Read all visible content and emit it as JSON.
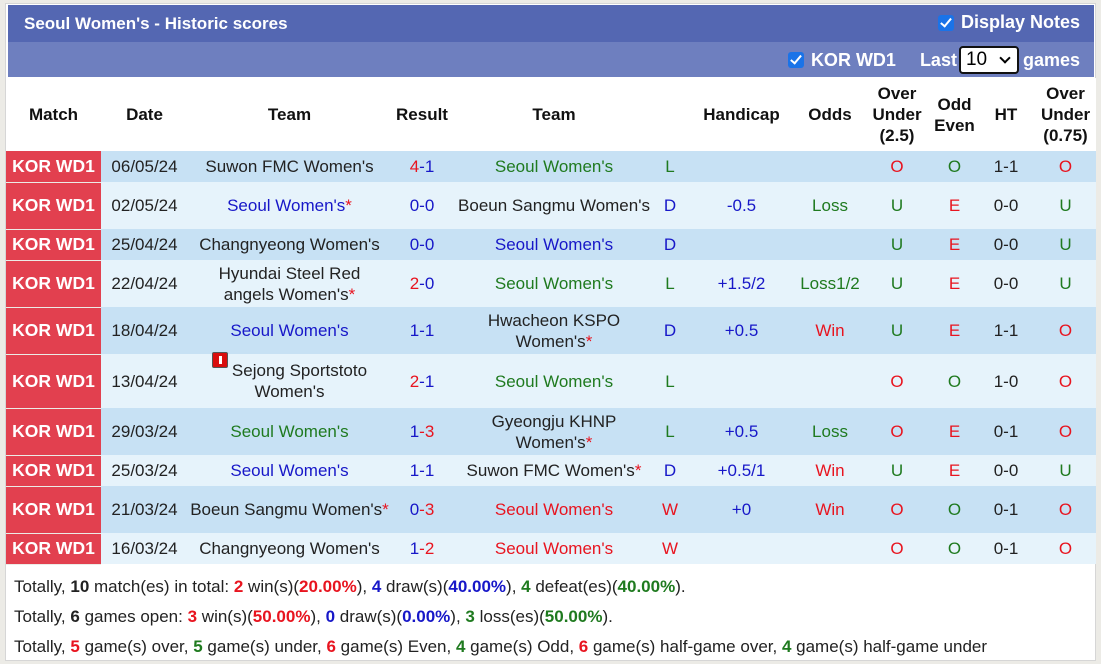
{
  "header": {
    "title": "Seoul Women's - Historic scores",
    "display_notes_label": "Display Notes",
    "display_notes_checked": true
  },
  "filter": {
    "league_label": "KOR WD1",
    "league_checked": true,
    "last_label": "Last",
    "games_count": "10",
    "games_label": "games"
  },
  "columns": [
    "Match",
    "Date",
    "Team",
    "Result",
    "Team",
    "",
    "Handicap",
    "Odds",
    "Over Under (2.5)",
    "Odd Even",
    "HT",
    "Over Under (0.75)"
  ],
  "colors": {
    "league_bg": "#e2404f",
    "header_bg": "#5467b2",
    "filter_bg": "#6e7fbf",
    "win": "#e8141f",
    "draw": "#1717c8",
    "loss": "#1f7a1f"
  },
  "rows": [
    {
      "league": "KOR WD1",
      "date": "06/05/24",
      "home": "Suwon FMC Women's",
      "home_star": false,
      "home_color": "black",
      "home_redcard": false,
      "score_h": "4",
      "score_a": "1",
      "sh_color": "red",
      "sa_color": "blue",
      "away": "Seoul Women's",
      "away_star": false,
      "away_color": "green",
      "wdl": "L",
      "wdl_color": "green",
      "handicap": "",
      "odds": "",
      "odds_color": "",
      "ou": "O",
      "ou_color": "red",
      "oe": "O",
      "oe_color": "green",
      "ht": "1-1",
      "ou2": "O",
      "ou2_color": "red"
    },
    {
      "league": "KOR WD1",
      "date": "02/05/24",
      "home": "Seoul Women's",
      "home_star": true,
      "home_color": "blue",
      "home_redcard": false,
      "score_h": "0",
      "score_a": "0",
      "sh_color": "blue",
      "sa_color": "blue",
      "away": "Boeun Sangmu Women's",
      "away_star": false,
      "away_color": "black",
      "wdl": "D",
      "wdl_color": "blue",
      "handicap": "-0.5",
      "odds": "Loss",
      "odds_color": "green",
      "ou": "U",
      "ou_color": "green",
      "oe": "E",
      "oe_color": "red",
      "ht": "0-0",
      "ou2": "U",
      "ou2_color": "green"
    },
    {
      "league": "KOR WD1",
      "date": "25/04/24",
      "home": "Changnyeong Women's",
      "home_star": false,
      "home_color": "black",
      "home_redcard": false,
      "score_h": "0",
      "score_a": "0",
      "sh_color": "blue",
      "sa_color": "blue",
      "away": "Seoul Women's",
      "away_star": false,
      "away_color": "blue",
      "wdl": "D",
      "wdl_color": "blue",
      "handicap": "",
      "odds": "",
      "odds_color": "",
      "ou": "U",
      "ou_color": "green",
      "oe": "E",
      "oe_color": "red",
      "ht": "0-0",
      "ou2": "U",
      "ou2_color": "green"
    },
    {
      "league": "KOR WD1",
      "date": "22/04/24",
      "home": "Hyundai Steel Red angels Women's",
      "home_star": true,
      "home_color": "black",
      "home_redcard": false,
      "score_h": "2",
      "score_a": "0",
      "sh_color": "red",
      "sa_color": "blue",
      "away": "Seoul Women's",
      "away_star": false,
      "away_color": "green",
      "wdl": "L",
      "wdl_color": "green",
      "handicap": "+1.5/2",
      "odds": "Loss1/2",
      "odds_color": "green",
      "ou": "U",
      "ou_color": "green",
      "oe": "E",
      "oe_color": "red",
      "ht": "0-0",
      "ou2": "U",
      "ou2_color": "green"
    },
    {
      "league": "KOR WD1",
      "date": "18/04/24",
      "home": "Seoul Women's",
      "home_star": false,
      "home_color": "blue",
      "home_redcard": false,
      "score_h": "1",
      "score_a": "1",
      "sh_color": "blue",
      "sa_color": "blue",
      "away": "Hwacheon KSPO Women's",
      "away_star": true,
      "away_color": "black",
      "wdl": "D",
      "wdl_color": "blue",
      "handicap": "+0.5",
      "odds": "Win",
      "odds_color": "red",
      "ou": "U",
      "ou_color": "green",
      "oe": "E",
      "oe_color": "red",
      "ht": "1-1",
      "ou2": "O",
      "ou2_color": "red"
    },
    {
      "league": "KOR WD1",
      "date": "13/04/24",
      "home": "Sejong Sportstoto Women's",
      "home_star": false,
      "home_color": "black",
      "home_redcard": true,
      "score_h": "2",
      "score_a": "1",
      "sh_color": "red",
      "sa_color": "blue",
      "away": "Seoul Women's",
      "away_star": false,
      "away_color": "green",
      "wdl": "L",
      "wdl_color": "green",
      "handicap": "",
      "odds": "",
      "odds_color": "",
      "ou": "O",
      "ou_color": "red",
      "oe": "O",
      "oe_color": "green",
      "ht": "1-0",
      "ou2": "O",
      "ou2_color": "red"
    },
    {
      "league": "KOR WD1",
      "date": "29/03/24",
      "home": "Seoul Women's",
      "home_star": false,
      "home_color": "green",
      "home_redcard": false,
      "score_h": "1",
      "score_a": "3",
      "sh_color": "blue",
      "sa_color": "red",
      "away": "Gyeongju KHNP Women's",
      "away_star": true,
      "away_color": "black",
      "wdl": "L",
      "wdl_color": "green",
      "handicap": "+0.5",
      "odds": "Loss",
      "odds_color": "green",
      "ou": "O",
      "ou_color": "red",
      "oe": "E",
      "oe_color": "red",
      "ht": "0-1",
      "ou2": "O",
      "ou2_color": "red"
    },
    {
      "league": "KOR WD1",
      "date": "25/03/24",
      "home": "Seoul Women's",
      "home_star": false,
      "home_color": "blue",
      "home_redcard": false,
      "score_h": "1",
      "score_a": "1",
      "sh_color": "blue",
      "sa_color": "blue",
      "away": "Suwon FMC Women's",
      "away_star": true,
      "away_color": "black",
      "wdl": "D",
      "wdl_color": "blue",
      "handicap": "+0.5/1",
      "odds": "Win",
      "odds_color": "red",
      "ou": "U",
      "ou_color": "green",
      "oe": "E",
      "oe_color": "red",
      "ht": "0-0",
      "ou2": "U",
      "ou2_color": "green"
    },
    {
      "league": "KOR WD1",
      "date": "21/03/24",
      "home": "Boeun Sangmu Women's",
      "home_star": true,
      "home_color": "black",
      "home_redcard": false,
      "score_h": "0",
      "score_a": "3",
      "sh_color": "blue",
      "sa_color": "red",
      "away": "Seoul Women's",
      "away_star": false,
      "away_color": "red",
      "wdl": "W",
      "wdl_color": "red",
      "handicap": "+0",
      "odds": "Win",
      "odds_color": "red",
      "ou": "O",
      "ou_color": "red",
      "oe": "O",
      "oe_color": "green",
      "ht": "0-1",
      "ou2": "O",
      "ou2_color": "red"
    },
    {
      "league": "KOR WD1",
      "date": "16/03/24",
      "home": "Changnyeong Women's",
      "home_star": false,
      "home_color": "black",
      "home_redcard": false,
      "score_h": "1",
      "score_a": "2",
      "sh_color": "blue",
      "sa_color": "red",
      "away": "Seoul Women's",
      "away_star": false,
      "away_color": "red",
      "wdl": "W",
      "wdl_color": "red",
      "handicap": "",
      "odds": "",
      "odds_color": "",
      "ou": "O",
      "ou_color": "red",
      "oe": "O",
      "oe_color": "green",
      "ht": "0-1",
      "ou2": "O",
      "ou2_color": "red"
    }
  ],
  "summary": [
    [
      {
        "t": "Totally, ",
        "c": ""
      },
      {
        "t": "10",
        "c": "black",
        "b": true
      },
      {
        "t": " match(es) in total: ",
        "c": ""
      },
      {
        "t": "2",
        "c": "red",
        "b": true
      },
      {
        "t": " win(s)(",
        "c": ""
      },
      {
        "t": "20.00%",
        "c": "red",
        "b": true
      },
      {
        "t": "), ",
        "c": ""
      },
      {
        "t": "4",
        "c": "blue",
        "b": true
      },
      {
        "t": " draw(s)(",
        "c": ""
      },
      {
        "t": "40.00%",
        "c": "blue",
        "b": true
      },
      {
        "t": "), ",
        "c": ""
      },
      {
        "t": "4",
        "c": "green",
        "b": true
      },
      {
        "t": " defeat(es)(",
        "c": ""
      },
      {
        "t": "40.00%",
        "c": "green",
        "b": true
      },
      {
        "t": ").",
        "c": ""
      }
    ],
    [
      {
        "t": "Totally, ",
        "c": ""
      },
      {
        "t": "6",
        "c": "black",
        "b": true
      },
      {
        "t": " games open: ",
        "c": ""
      },
      {
        "t": "3",
        "c": "red",
        "b": true
      },
      {
        "t": " win(s)(",
        "c": ""
      },
      {
        "t": "50.00%",
        "c": "red",
        "b": true
      },
      {
        "t": "), ",
        "c": ""
      },
      {
        "t": "0",
        "c": "blue",
        "b": true
      },
      {
        "t": " draw(s)(",
        "c": ""
      },
      {
        "t": "0.00%",
        "c": "blue",
        "b": true
      },
      {
        "t": "), ",
        "c": ""
      },
      {
        "t": "3",
        "c": "green",
        "b": true
      },
      {
        "t": " loss(es)(",
        "c": ""
      },
      {
        "t": "50.00%",
        "c": "green",
        "b": true
      },
      {
        "t": ").",
        "c": ""
      }
    ],
    [
      {
        "t": "Totally, ",
        "c": ""
      },
      {
        "t": "5",
        "c": "red",
        "b": true
      },
      {
        "t": " game(s) over, ",
        "c": ""
      },
      {
        "t": "5",
        "c": "green",
        "b": true
      },
      {
        "t": " game(s) under, ",
        "c": ""
      },
      {
        "t": "6",
        "c": "red",
        "b": true
      },
      {
        "t": " game(s) Even, ",
        "c": ""
      },
      {
        "t": "4",
        "c": "green",
        "b": true
      },
      {
        "t": " game(s) Odd, ",
        "c": ""
      },
      {
        "t": "6",
        "c": "red",
        "b": true
      },
      {
        "t": " game(s) half-game over, ",
        "c": ""
      },
      {
        "t": "4",
        "c": "green",
        "b": true
      },
      {
        "t": " game(s) half-game under",
        "c": ""
      }
    ]
  ]
}
